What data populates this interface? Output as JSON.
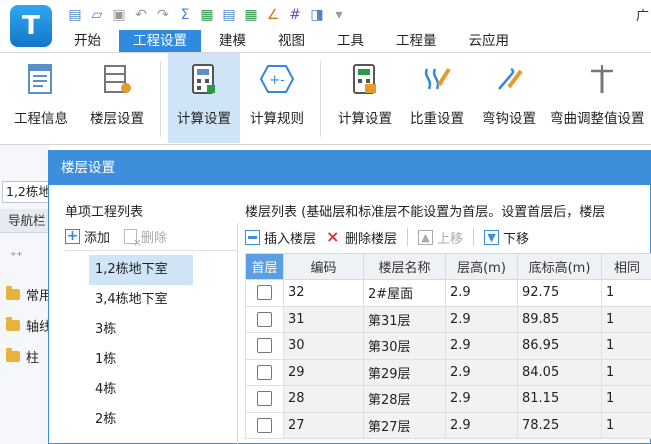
{
  "app": {
    "logo_letter": "T",
    "title_fragment": "广"
  },
  "tabs": [
    "开始",
    "工程设置",
    "建模",
    "视图",
    "工具",
    "工程量",
    "云应用"
  ],
  "ribbon": {
    "project_info": "工程信息",
    "floor_settings": "楼层设置",
    "calc_settings": "计算设置",
    "calc_rules": "计算规则",
    "calc_settings_2": "计算设置",
    "density_settings": "比重设置",
    "hook_settings": "弯钩设置",
    "bend_adjust": "弯曲调整值设置"
  },
  "left_strip": {
    "combo_value": "1,2栋地",
    "nav_label": "导航栏",
    "items": [
      "常用",
      "轴线",
      "柱"
    ]
  },
  "dialog": {
    "title": "楼层设置",
    "left_panel": {
      "title": "单项工程列表",
      "add": "添加",
      "delete": "删除",
      "items": [
        "1,2栋地下室",
        "3,4栋地下室",
        "3栋",
        "1栋",
        "4栋",
        "2栋"
      ]
    },
    "right_panel": {
      "title": "楼层列表 (基础层和标准层不能设置为首层。设置首层后，楼层",
      "insert": "插入楼层",
      "delete": "删除楼层",
      "up": "上移",
      "down": "下移",
      "columns": [
        "首层",
        "编码",
        "楼层名称",
        "层高(m)",
        "底标高(m)",
        "相同"
      ],
      "rows": [
        {
          "code": "32",
          "name": "2#屋面",
          "height": "2.9",
          "bottom": "92.75",
          "same": "1"
        },
        {
          "code": "31",
          "name": "第31层",
          "height": "2.9",
          "bottom": "89.85",
          "same": "1"
        },
        {
          "code": "30",
          "name": "第30层",
          "height": "2.9",
          "bottom": "86.95",
          "same": "1"
        },
        {
          "code": "29",
          "name": "第29层",
          "height": "2.9",
          "bottom": "84.05",
          "same": "1"
        },
        {
          "code": "28",
          "name": "第28层",
          "height": "2.9",
          "bottom": "81.15",
          "same": "1"
        },
        {
          "code": "27",
          "name": "第27层",
          "height": "2.9",
          "bottom": "78.25",
          "same": "1"
        }
      ]
    }
  },
  "colors": {
    "accent": "#2f8ae0",
    "dialog_title_bg": "#3d8fdb",
    "selected_bg": "#cfe5f7"
  }
}
